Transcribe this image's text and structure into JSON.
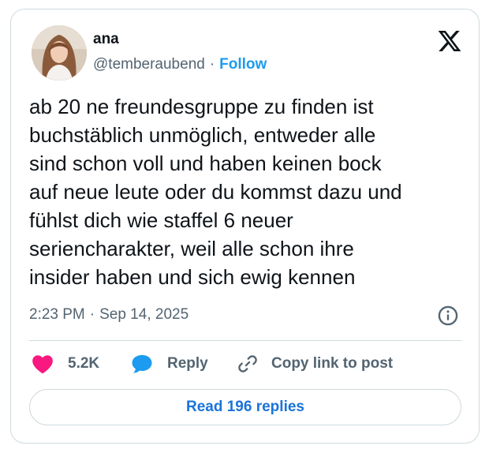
{
  "author": {
    "name": "ana",
    "handle": "@temberaubend",
    "separator": "·",
    "follow_label": "Follow"
  },
  "tweet": {
    "lines": [
      "ab 20 ne freundesgruppe zu finden ist",
      "buchstäblich unmöglich, entweder alle",
      "sind schon voll und haben keinen bock",
      "auf neue leute oder du kommst dazu und",
      "fühlst dich wie staffel 6 neuer",
      "seriencharakter, weil alle schon ihre",
      "insider haben und sich ewig kennen"
    ],
    "time": "2:23 PM",
    "separator": "·",
    "date": "Sep 14, 2025"
  },
  "actions": {
    "like_count": "5.2K",
    "reply_label": "Reply",
    "copy_label": "Copy link to post"
  },
  "read_replies_label": "Read 196 replies",
  "icons": {
    "logo": "x-logo-icon",
    "info": "info-icon",
    "like": "heart-icon",
    "reply": "speech-bubble-icon",
    "copy": "link-icon"
  },
  "colors": {
    "like": "#f91880",
    "reply": "#1d9bf0",
    "follow": "#1d9bf0",
    "read_replies": "#1d6ff0",
    "secondary_text": "#536471",
    "border": "#cfd9de"
  }
}
